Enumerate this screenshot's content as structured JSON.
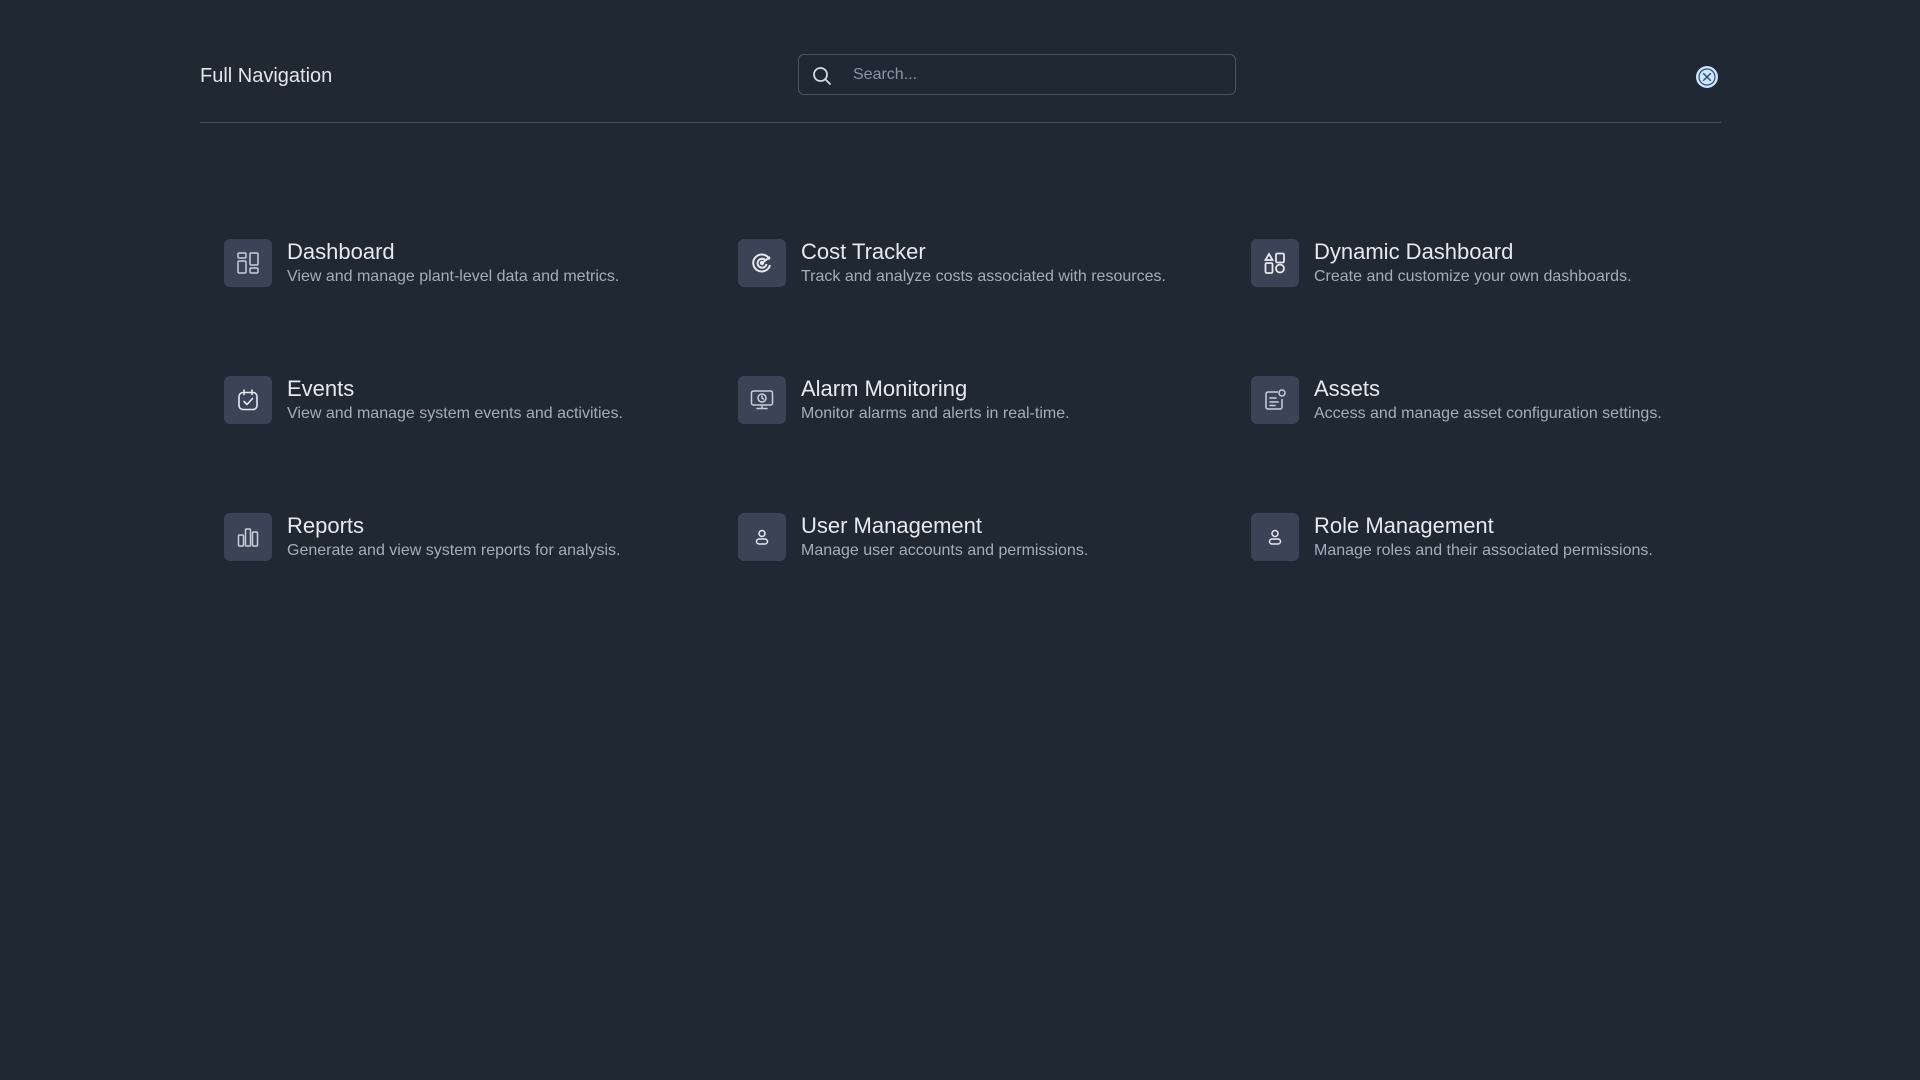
{
  "header": {
    "title": "Full Navigation",
    "search_placeholder": "Search...",
    "search_value": "",
    "close_icon": "close-icon"
  },
  "nav_items": [
    {
      "title": "Dashboard",
      "description": "View and manage plant-level data and metrics.",
      "icon": "dashboard-icon"
    },
    {
      "title": "Cost Tracker",
      "description": "Track and analyze costs associated with resources.",
      "icon": "cost-tracker-icon"
    },
    {
      "title": "Dynamic Dashboard",
      "description": "Create and customize your own dashboards.",
      "icon": "dynamic-dashboard-icon"
    },
    {
      "title": "Events",
      "description": "View and manage system events and activities.",
      "icon": "calendar-check-icon"
    },
    {
      "title": "Alarm Monitoring",
      "description": "Monitor alarms and alerts in real-time.",
      "icon": "monitor-alarm-icon"
    },
    {
      "title": "Assets",
      "description": "Access and manage asset configuration settings.",
      "icon": "asset-settings-icon"
    },
    {
      "title": "Reports",
      "description": "Generate and view system reports for analysis.",
      "icon": "bar-chart-icon"
    },
    {
      "title": "User Management",
      "description": "Manage user accounts and permissions.",
      "icon": "user-icon"
    },
    {
      "title": "Role Management",
      "description": "Manage roles and their associated permissions.",
      "icon": "user-icon"
    }
  ],
  "colors": {
    "background": "#1f2833",
    "icon_tile": "#3b4456",
    "close_button": "#cfe4ff",
    "divider": "#465060"
  }
}
